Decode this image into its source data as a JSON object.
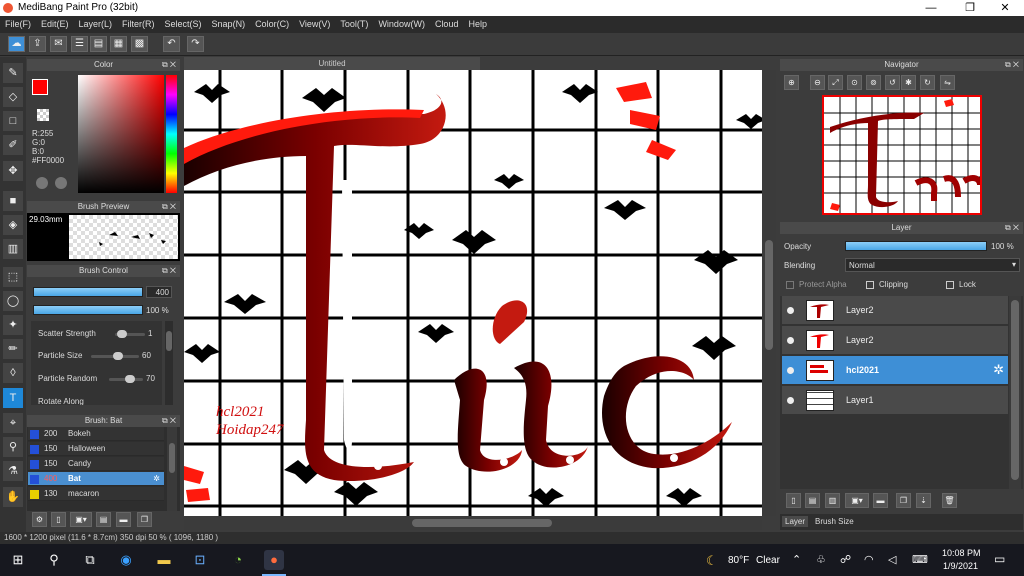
{
  "window": {
    "title": "MediBang Paint Pro (32bit)",
    "minimize": "—",
    "maximize": "❐",
    "close": "✕"
  },
  "menu": [
    "File(F)",
    "Edit(E)",
    "Layer(L)",
    "Filter(R)",
    "Select(S)",
    "Snap(N)",
    "Color(C)",
    "View(V)",
    "Tool(T)",
    "Window(W)",
    "Cloud",
    "Help"
  ],
  "color_panel": {
    "title": "Color",
    "r": "R:255",
    "g": "G:0",
    "b": "B:0",
    "hex": "#FF0000",
    "primary": "#FF0000"
  },
  "brush_preview": {
    "title": "Brush Preview",
    "size": "29.03mm"
  },
  "brush_control": {
    "title": "Brush Control",
    "size_value": "400",
    "opacity_value": "100 %",
    "params": [
      {
        "label": "Scatter Strength",
        "value": "1"
      },
      {
        "label": "Particle Size",
        "value": "60"
      },
      {
        "label": "Particle Random",
        "value": "70"
      }
    ],
    "cut_label": "Rotate Along"
  },
  "brush_list": {
    "title": "Brush: Bat",
    "items": [
      {
        "size": "200",
        "name": "Bokeh"
      },
      {
        "size": "150",
        "name": "Halloween"
      },
      {
        "size": "150",
        "name": "Candy"
      },
      {
        "size": "400",
        "name": "Bat",
        "selected": true
      },
      {
        "size": "130",
        "name": "macaron"
      }
    ]
  },
  "document": {
    "tab": "Untitled",
    "watermark_line1": "hcl2021",
    "watermark_line2": "Hoidap247"
  },
  "navigator": {
    "title": "Navigator"
  },
  "layer_panel": {
    "title": "Layer",
    "opacity_label": "Opacity",
    "opacity_value": "100 %",
    "blending_label": "Blending",
    "blending_value": "Normal",
    "protect_alpha": "Protect Alpha",
    "clipping": "Clipping",
    "lock": "Lock",
    "layers": [
      {
        "name": "Layer2"
      },
      {
        "name": "Layer2"
      },
      {
        "name": "hcl2021",
        "selected": true
      },
      {
        "name": "Layer1"
      }
    ],
    "tabs": [
      "Layer",
      "Brush Size"
    ]
  },
  "status": "1600 * 1200 pixel  (11.6 * 8.7cm)  350 dpi  50 %  ( 1096, 1180 )",
  "taskbar": {
    "weather_temp": "80°F",
    "weather_text": "Clear",
    "time": "10:08 PM",
    "date": "1/9/2021"
  }
}
